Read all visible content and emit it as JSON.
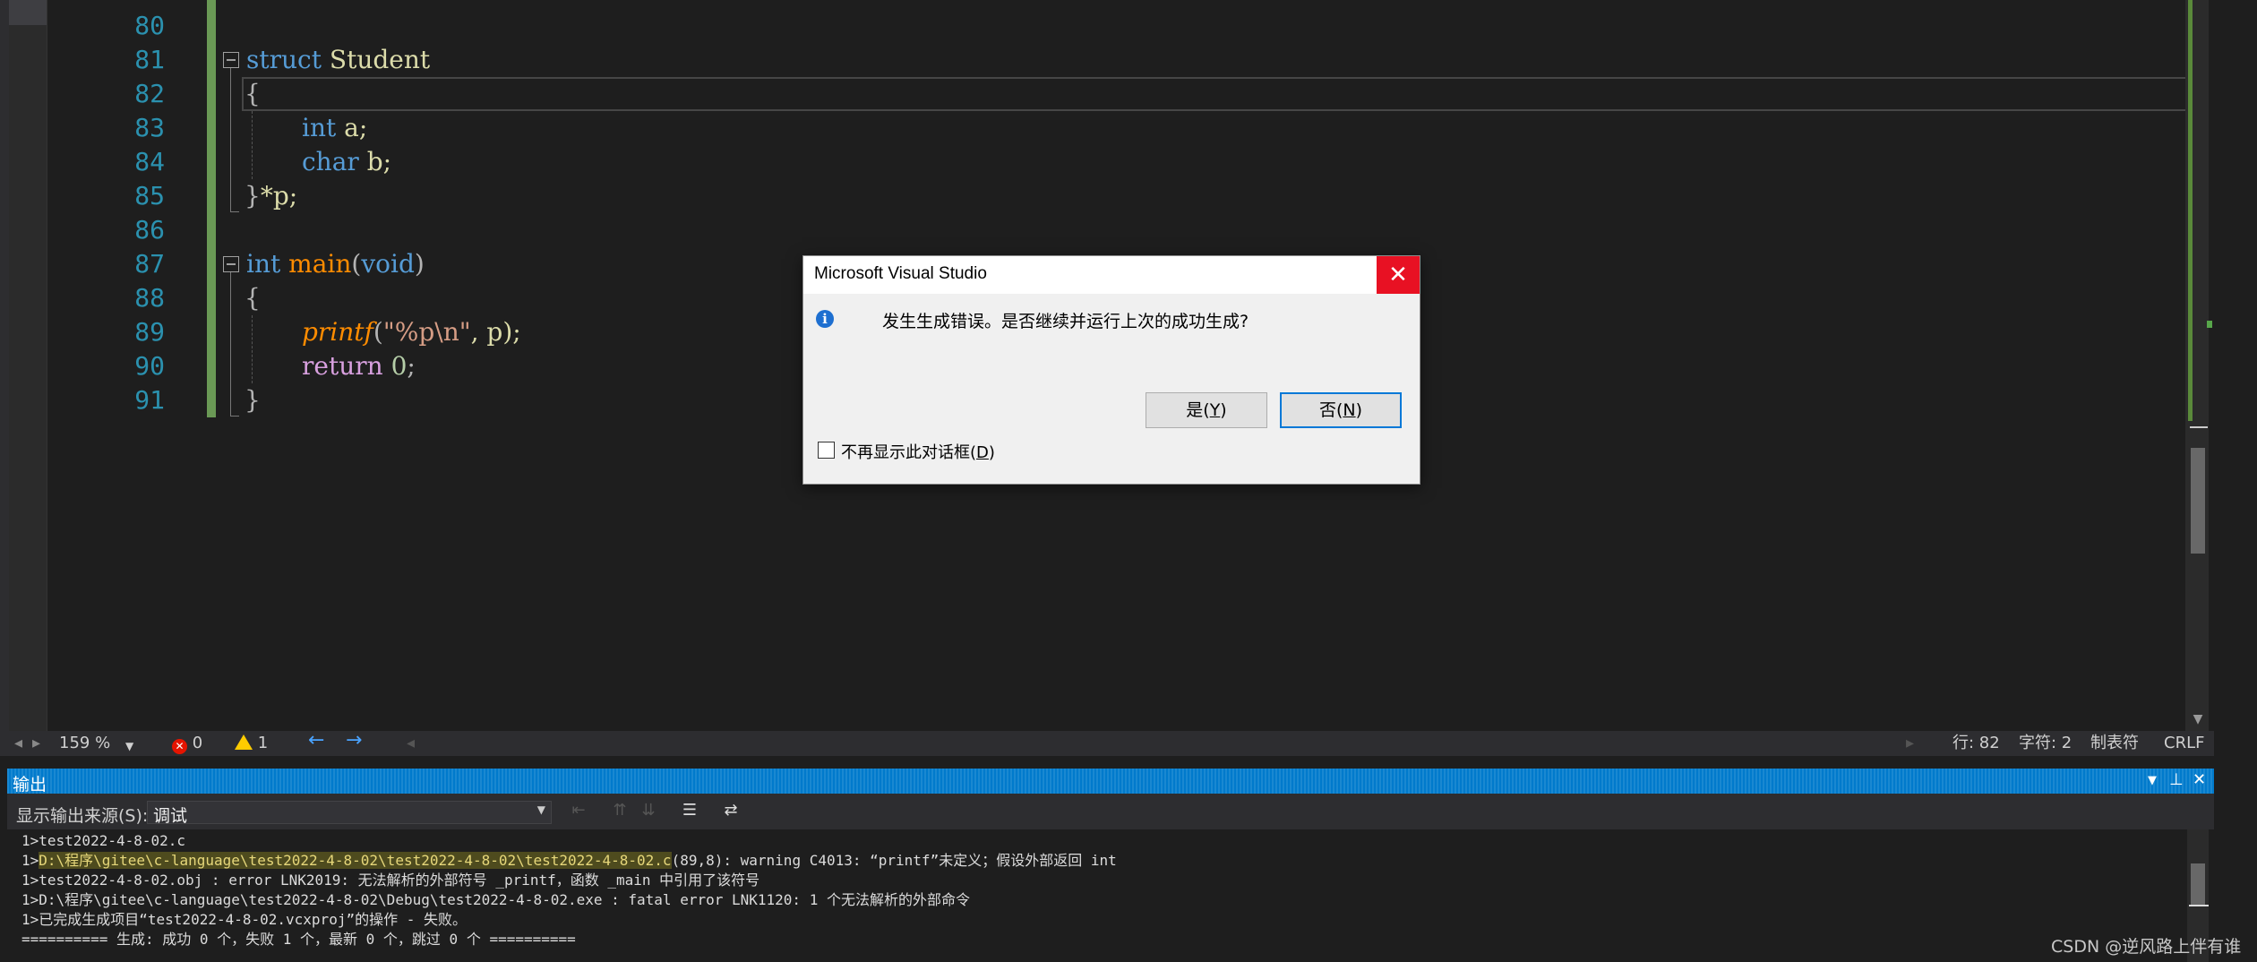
{
  "editor": {
    "lines": [
      {
        "number": "80"
      },
      {
        "number": "81"
      },
      {
        "number": "82"
      },
      {
        "number": "83"
      },
      {
        "number": "84"
      },
      {
        "number": "85"
      },
      {
        "number": "86"
      },
      {
        "number": "87"
      },
      {
        "number": "88"
      },
      {
        "number": "89"
      },
      {
        "number": "90"
      },
      {
        "number": "91"
      }
    ],
    "tokens": {
      "struct_kw": "struct",
      "struct_name": "Student",
      "brace_open_1": "{",
      "int_kw_1": "int",
      "field_a": "a;",
      "char_kw": "char",
      "field_b": "b;",
      "brace_close_1": "}",
      "ptr_decl": "*p;",
      "int_kw_2": "int",
      "main_name": "main",
      "paren_open": "(",
      "void_kw": "void",
      "paren_close": ")",
      "brace_open_2": "{",
      "printf_name": "printf",
      "printf_args_open": "(",
      "printf_format": "\"%p\\n\"",
      "printf_args_rest": ", p);",
      "return_kw": "return",
      "return_val": "0",
      "return_semi": ";",
      "brace_close_2": "}"
    }
  },
  "status_bar": {
    "zoom": "159 %",
    "errors": "0",
    "warnings": "1",
    "line": "行: 82",
    "char": "字符: 2",
    "indent": "制表符",
    "eol": "CRLF"
  },
  "output": {
    "title": "输出",
    "source_label": "显示输出来源(S):",
    "source_value": "调试",
    "lines": {
      "l1": "1>test2022-4-8-02.c",
      "l2_prefix": "1>",
      "l2_path": "D:\\程序\\gitee\\c-language\\test2022-4-8-02\\test2022-4-8-02\\test2022-4-8-02.c",
      "l2_rest": "(89,8): warning C4013: “printf”未定义；假设外部返回 int",
      "l3": "1>test2022-4-8-02.obj : error LNK2019: 无法解析的外部符号 _printf，函数 _main 中引用了该符号",
      "l4": "1>D:\\程序\\gitee\\c-language\\test2022-4-8-02\\Debug\\test2022-4-8-02.exe : fatal error LNK1120: 1 个无法解析的外部命令",
      "l5": "1>已完成生成项目“test2022-4-8-02.vcxproj”的操作 - 失败。",
      "l6": "========== 生成: 成功 0 个，失败 1 个，最新 0 个，跳过 0 个 =========="
    }
  },
  "dialog": {
    "title": "Microsoft Visual Studio",
    "message": "发生生成错误。是否继续并运行上次的成功生成?",
    "yes_main": "是(",
    "yes_key": "Y",
    "yes_end": ")",
    "no_main": "否(",
    "no_key": "N",
    "no_end": ")",
    "dont_show_main": "不再显示此对话框(",
    "dont_show_key": "D",
    "dont_show_end": ")"
  },
  "watermark": "CSDN @逆风路上伴有谁",
  "icons": {
    "close": "close-icon",
    "info": "info-icon",
    "error": "error-icon",
    "warning": "warning-icon"
  },
  "colors": {
    "accent": "#007acc",
    "close_red": "#e81123",
    "change_bar": "#6a9955"
  }
}
